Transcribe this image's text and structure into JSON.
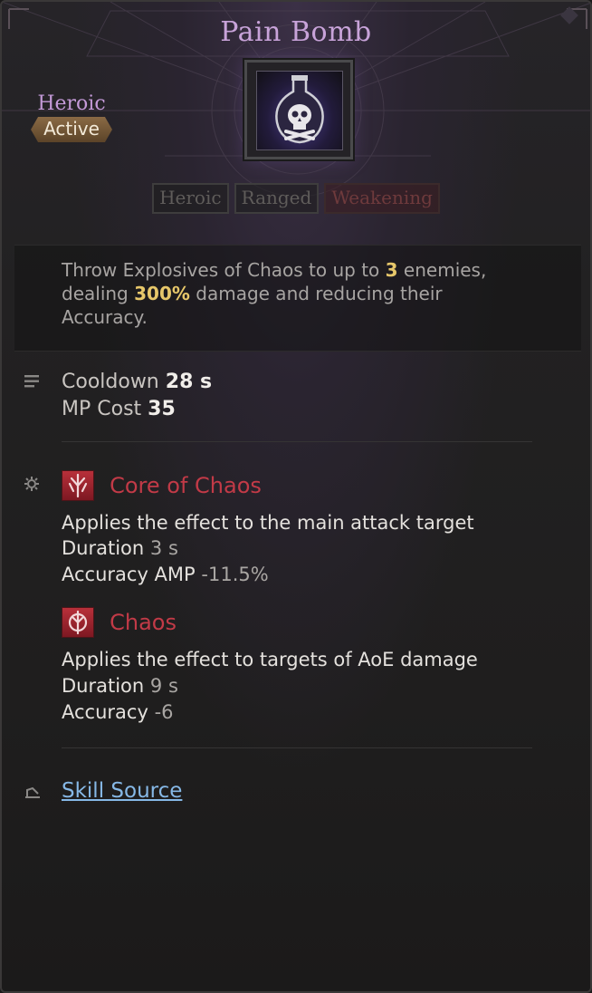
{
  "skill": {
    "name": "Pain Bomb",
    "grade": "Heroic",
    "type": "Active",
    "icon": "skull-potion-icon",
    "tags": [
      "Heroic",
      "Ranged",
      "Weakening"
    ]
  },
  "description": {
    "pre": "Throw Explosives of Chaos to up to ",
    "targets": "3",
    "mid": " enemies, dealing ",
    "damage": "300%",
    "post": " damage and reducing their Accuracy."
  },
  "stats": {
    "icon": "list-icon",
    "cooldown_label": "Cooldown",
    "cooldown_value": "28 s",
    "mp_label": "MP Cost",
    "mp_value": "35"
  },
  "effects": {
    "icon": "gear-icon",
    "items": [
      {
        "name": "Core of Chaos",
        "icon": "chaos-core-icon",
        "desc": "Applies the effect to the main attack target",
        "duration_label": "Duration",
        "duration_value": "3 s",
        "stat_label": "Accuracy AMP",
        "stat_value": "-11.5%"
      },
      {
        "name": "Chaos",
        "icon": "chaos-icon",
        "desc": "Applies the effect to targets of AoE damage",
        "duration_label": "Duration",
        "duration_value": "9 s",
        "stat_label": "Accuracy",
        "stat_value": "-6"
      }
    ]
  },
  "source": {
    "icon": "book-icon",
    "label": "Skill Source"
  },
  "colors": {
    "title": "#c8a3d9",
    "grade": "#c49ad8",
    "highlight": "#e7c76a",
    "effect": "#c23a47",
    "link": "#86b8e6"
  }
}
